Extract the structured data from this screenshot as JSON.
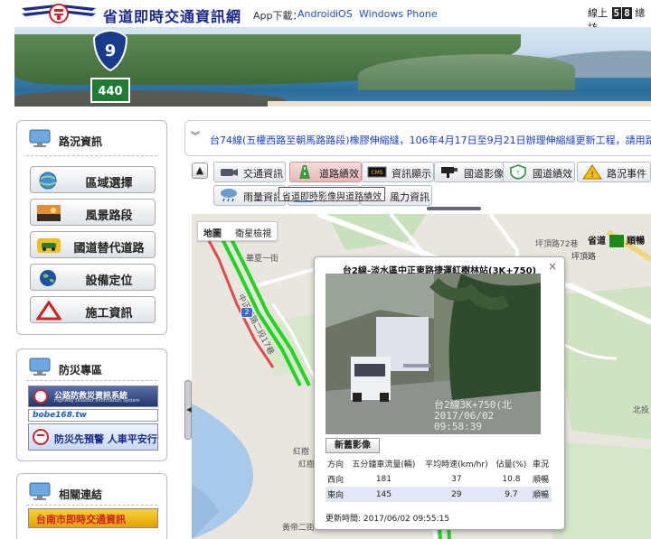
{
  "header": {
    "site_title": "省道即時交通資訊網",
    "app_download_label": "App下載：",
    "app_links": [
      "Android",
      "iOS",
      "Windows Phone"
    ],
    "online_label": "線上",
    "online_digits": [
      "5",
      "8"
    ],
    "total_label": "總訪"
  },
  "banner": {
    "route_sign": "9",
    "road_sign": "440"
  },
  "sidebar": {
    "road_info": {
      "title": "路況資訊",
      "items": [
        {
          "label": "區域選擇",
          "icon": "globe-icon"
        },
        {
          "label": "風景路段",
          "icon": "landscape-icon"
        },
        {
          "label": "國道替代道路",
          "icon": "car-icon"
        },
        {
          "label": "設備定位",
          "icon": "earth-icon"
        },
        {
          "label": "施工資訊",
          "icon": "warning-icon"
        }
      ]
    },
    "disaster": {
      "title": "防災專區",
      "promos": [
        {
          "line1": "公路防救災資訊系統",
          "line2": "Highway Disaster Information System"
        },
        {
          "line1": "bobe168.tw",
          "line2": ""
        },
        {
          "line1": "防災先預警 人車平安行",
          "line2": ""
        }
      ]
    },
    "links": {
      "title": "相關連結",
      "promos": [
        {
          "line1": "台南市即時交通資訊",
          "line2": ""
        }
      ]
    }
  },
  "marquee": {
    "text": "台74線(五權西路至朝馬路路段)橡膠伸縮縫，106年4月17日至9月21日辦理伸縮縫更新工程，請用路人"
  },
  "toolbar": {
    "row1": [
      {
        "label": "交通資訊",
        "icon": "camera-icon",
        "active": false
      },
      {
        "label": "道路績效",
        "icon": "road-icon",
        "active": true
      },
      {
        "label": "資訊顯示",
        "icon": "cms-sign-icon",
        "active": false
      },
      {
        "label": "國道影像",
        "icon": "cctv-icon",
        "active": false
      },
      {
        "label": "國道績效",
        "icon": "shield-icon",
        "active": false
      },
      {
        "label": "路況事件",
        "icon": "alert-icon",
        "active": false
      }
    ],
    "row2": [
      {
        "label": "雨量資訊",
        "icon": "rain-icon",
        "active": false
      },
      {
        "label": "影像",
        "icon": "water-icon",
        "active": false
      },
      {
        "label": "風力資訊",
        "icon": "wind-icon",
        "active": false
      }
    ],
    "tooltip": "省道即時影像與道路績效"
  },
  "map": {
    "tabs": [
      "地圖",
      "衛星檢視"
    ],
    "legend": {
      "label1": "省道",
      "label2": "順暢",
      "color": "#1a8a1a"
    },
    "labels": [
      "坪頂路",
      "坪頂路72巷",
      "華夏一街",
      "紅樹",
      "北投",
      "黃帝二街",
      "紅樹林",
      "中正東路二段17巷"
    ],
    "route_badge": "2"
  },
  "popup": {
    "title": "台2線-淡水區中正東路捷運紅樹林站(3K+750)",
    "camera_overlay": [
      "台2線3K+750(北",
      "2017/06/02 09:58:39"
    ],
    "refresh_label": "新舊影像",
    "table": {
      "headers": [
        "方向",
        "五分鐘車流量(輛)",
        "平均時速(km/hr)",
        "佔量(%)",
        "車況"
      ],
      "rows": [
        [
          "西向",
          "181",
          "37",
          "10.8",
          "順暢"
        ],
        [
          "東向",
          "145",
          "29",
          "9.7",
          "順暢"
        ]
      ]
    },
    "update_time": "更新時間: 2017/06/02 09:55:15",
    "close_label": "×"
  },
  "colors": {
    "brand_blue": "#1a2a8a",
    "link_blue": "#1f4fd0",
    "road_green": "#22d422",
    "road_red": "#e24a4a"
  }
}
